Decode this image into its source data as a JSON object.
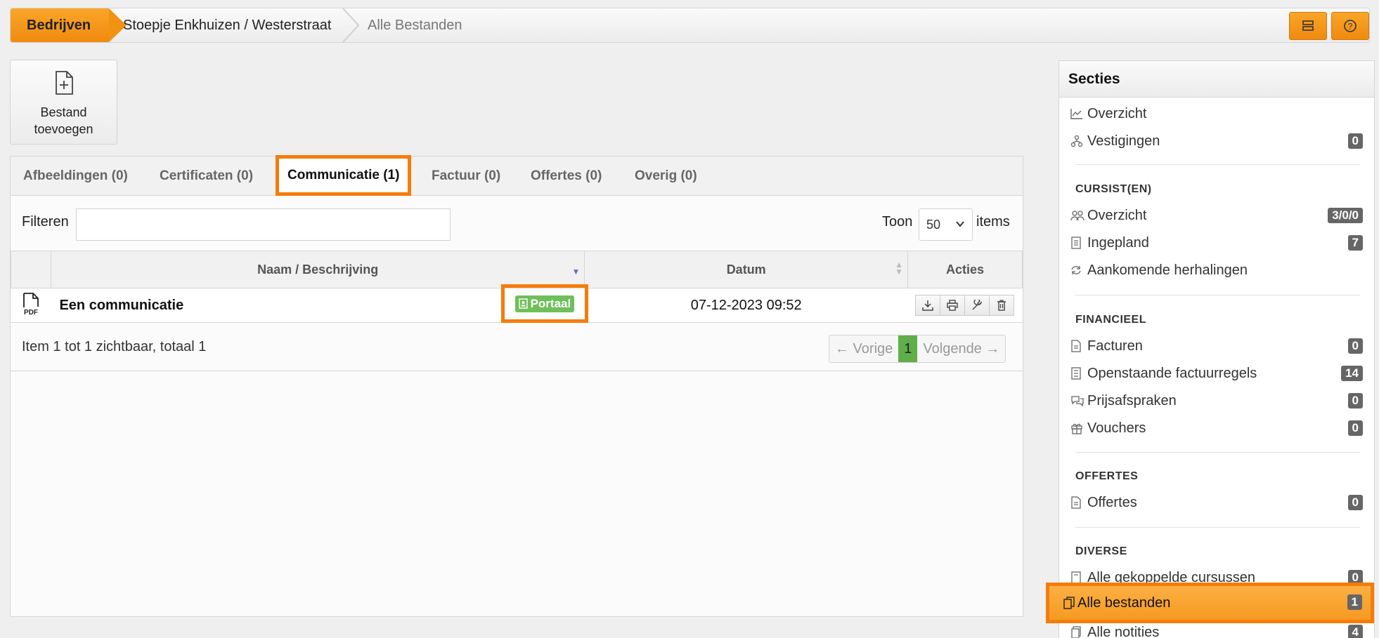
{
  "breadcrumb": {
    "items": [
      "Bedrijven",
      "Stoepje Enkhuizen / Westerstraat",
      "Alle Bestanden"
    ]
  },
  "toolbar": {
    "add_file_label_line1": "Bestand",
    "add_file_label_line2": "toevoegen"
  },
  "tabs": [
    {
      "label": "Afbeeldingen (0)"
    },
    {
      "label": "Certificaten (0)"
    },
    {
      "label": "Communicatie (1)"
    },
    {
      "label": "Factuur (0)"
    },
    {
      "label": "Offertes (0)"
    },
    {
      "label": "Overig (0)"
    }
  ],
  "active_tab": "Communicatie (1)",
  "filter": {
    "label": "Filteren",
    "value": "",
    "toon_label": "Toon",
    "toon_value": "50",
    "items_label": "items"
  },
  "table": {
    "headers": [
      "Naam / Beschrijving",
      "Datum",
      "Acties"
    ],
    "rows": [
      {
        "type": "PDF",
        "name": "Een communicatie",
        "badge": "Portaal",
        "date": "07-12-2023 09:52"
      }
    ]
  },
  "footer": {
    "count_text": "Item 1 tot 1 zichtbaar, totaal 1",
    "prev": "← Vorige",
    "current_page": "1",
    "next": "Volgende →"
  },
  "sidebar": {
    "title": "Secties",
    "top_items": [
      {
        "label": "Overzicht",
        "icon": "chart-icon"
      },
      {
        "label": "Vestigingen",
        "count": "0",
        "icon": "branch-icon"
      }
    ],
    "groups": [
      {
        "title": "CURSIST(EN)",
        "items": [
          {
            "label": "Overzicht",
            "count": "3/0/0"
          },
          {
            "label": "Ingepland",
            "count": "7"
          },
          {
            "label": "Aankomende herhalingen"
          }
        ]
      },
      {
        "title": "FINANCIEEL",
        "items": [
          {
            "label": "Facturen",
            "count": "0"
          },
          {
            "label": "Openstaande factuurregels",
            "count": "14"
          },
          {
            "label": "Prijsafspraken",
            "count": "0"
          },
          {
            "label": "Vouchers",
            "count": "0"
          }
        ]
      },
      {
        "title": "OFFERTES",
        "items": [
          {
            "label": "Offertes",
            "count": "0"
          }
        ]
      },
      {
        "title": "DIVERSE",
        "items": [
          {
            "label": "Alle gekoppelde cursussen",
            "count": "0"
          },
          {
            "label": "Alle bestanden",
            "count": "1"
          },
          {
            "label": "Alle notities",
            "count": "4"
          }
        ]
      }
    ]
  },
  "colors": {
    "accent": "#f29212",
    "highlight_border": "#f57c0a",
    "badge_green": "#6fbf5a"
  }
}
